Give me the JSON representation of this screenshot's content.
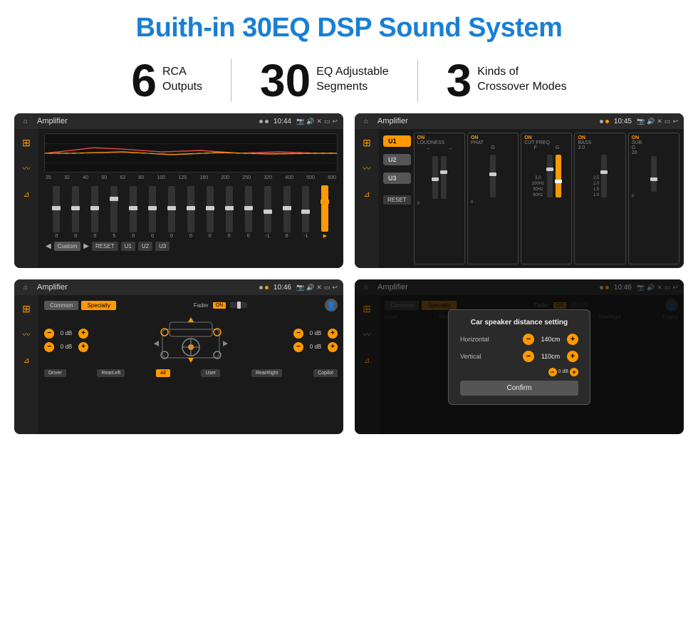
{
  "page": {
    "title": "Buith-in 30EQ DSP Sound System"
  },
  "stats": [
    {
      "number": "6",
      "line1": "RCA",
      "line2": "Outputs"
    },
    {
      "number": "30",
      "line1": "EQ Adjustable",
      "line2": "Segments"
    },
    {
      "number": "3",
      "line1": "Kinds of",
      "line2": "Crossover Modes"
    }
  ],
  "screens": {
    "eq": {
      "title": "Amplifier",
      "time": "10:44",
      "labels": [
        "25",
        "32",
        "40",
        "50",
        "63",
        "80",
        "100",
        "125",
        "160",
        "200",
        "250",
        "320",
        "400",
        "500",
        "630"
      ],
      "values": [
        "0",
        "0",
        "0",
        "5",
        "0",
        "0",
        "0",
        "0",
        "0",
        "0",
        "0",
        "-1",
        "0",
        "-1"
      ],
      "mode": "Custom",
      "presets": [
        "U1",
        "U2",
        "U3"
      ]
    },
    "crossover": {
      "title": "Amplifier",
      "time": "10:45",
      "units": [
        "U1",
        "U2",
        "U3"
      ],
      "panels": [
        "LOUDNESS",
        "PHAT",
        "CUT FREQ",
        "BASS",
        "SUB"
      ],
      "reset": "RESET"
    },
    "fader": {
      "title": "Amplifier",
      "time": "10:46",
      "tabs": [
        "Common",
        "Specialty"
      ],
      "faderLabel": "Fader",
      "onLabel": "ON",
      "dbValues": [
        "0 dB",
        "0 dB",
        "0 dB",
        "0 dB"
      ],
      "buttons": [
        "Driver",
        "RearLeft",
        "All",
        "User",
        "RearRight",
        "Copilot"
      ]
    },
    "dialog": {
      "title": "Amplifier",
      "time": "10:46",
      "tabs": [
        "Common",
        "Specialty"
      ],
      "dialogTitle": "Car speaker distance setting",
      "horizontal": {
        "label": "Horizontal",
        "value": "140cm"
      },
      "vertical": {
        "label": "Vertical",
        "value": "110cm"
      },
      "confirm": "Confirm",
      "dbValues": [
        "0 dB",
        "0 dB"
      ],
      "buttons": [
        "Driver",
        "RearLeft",
        "All",
        "User",
        "RearRight",
        "Copilot"
      ]
    }
  }
}
